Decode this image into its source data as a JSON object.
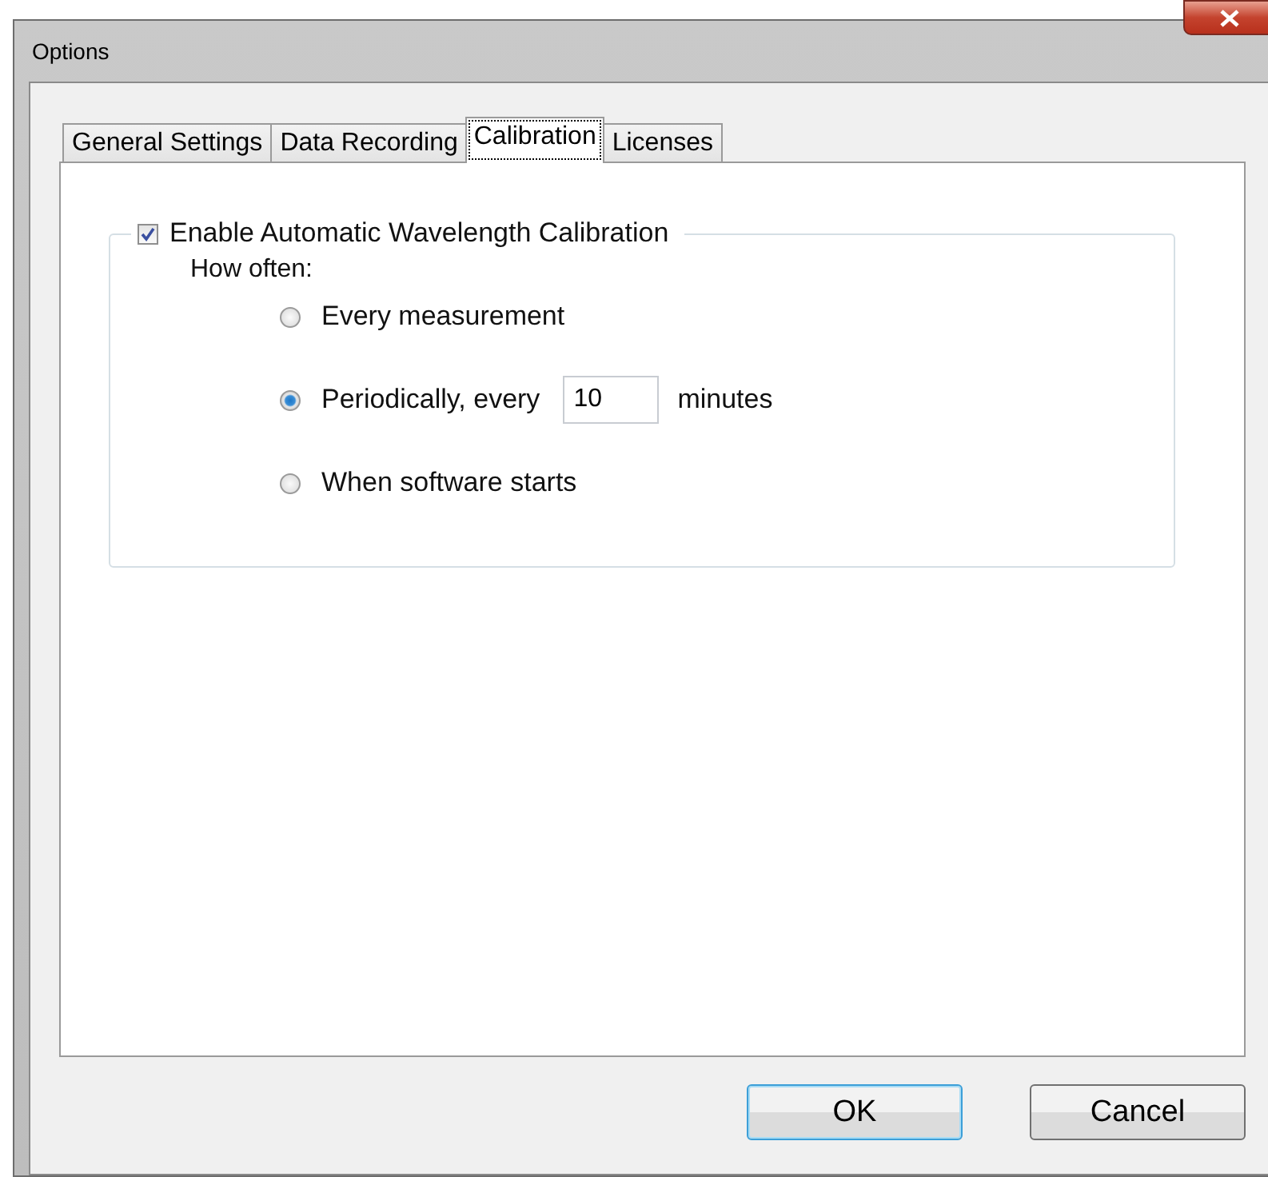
{
  "window": {
    "title": "Options"
  },
  "tabs": [
    {
      "label": "General Settings",
      "selected": false
    },
    {
      "label": "Data Recording",
      "selected": false
    },
    {
      "label": "Calibration",
      "selected": true
    },
    {
      "label": "Licenses",
      "selected": false
    }
  ],
  "calibration": {
    "enable": {
      "label": "Enable Automatic Wavelength Calibration",
      "checked": true
    },
    "how_often_label": "How often:",
    "options": [
      {
        "label": "Every measurement",
        "selected": false
      },
      {
        "label": "Periodically, every",
        "selected": true,
        "value": "10",
        "suffix": "minutes"
      },
      {
        "label": "When software starts",
        "selected": false
      }
    ]
  },
  "buttons": [
    {
      "label": "OK",
      "default": true
    },
    {
      "label": "Cancel",
      "default": false
    }
  ]
}
